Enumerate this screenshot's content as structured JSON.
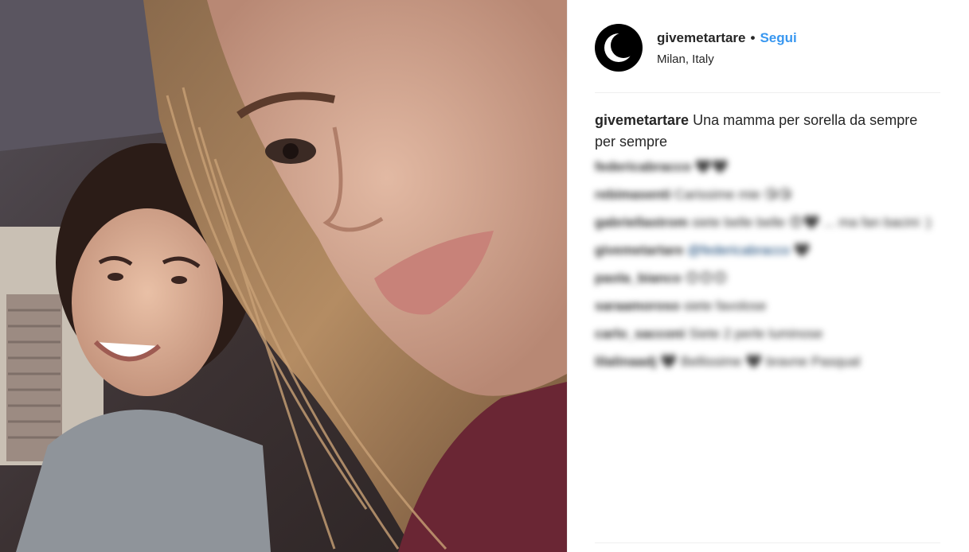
{
  "post": {
    "author": {
      "username": "givemetartare",
      "dot": "•",
      "follow_label": "Segui",
      "location": "Milan, Italy",
      "avatar_icon": "moon-figure-icon"
    },
    "caption": {
      "username": "givemetartare",
      "text": "Una mamma per sorella da sempre per sempre"
    },
    "comments": [
      {
        "username": "federicabracco",
        "text": "🖤🖤"
      },
      {
        "username": "rebimasenti",
        "text": "Carissime mie 😘😘"
      },
      {
        "username": "gabriellastrom",
        "text": "siete belle belle 😍🖤 ... ma fan bacini :)"
      },
      {
        "username": "givemetartare",
        "text": "@federicabracco 🖤"
      },
      {
        "username": "paola_bianco",
        "text": "😊😊😊"
      },
      {
        "username": "saraamoroso",
        "text": "siete favolose"
      },
      {
        "username": "carlo_sacconi",
        "text": "Siete 2 perle luminose"
      },
      {
        "username": "lilalinaadj",
        "text": "🖤 Bellissime 🖤 bravne Pasqual"
      }
    ],
    "photo_alt": "selfie"
  },
  "colors": {
    "accent": "#3897f0",
    "text": "#262626",
    "divider": "#efefef"
  }
}
